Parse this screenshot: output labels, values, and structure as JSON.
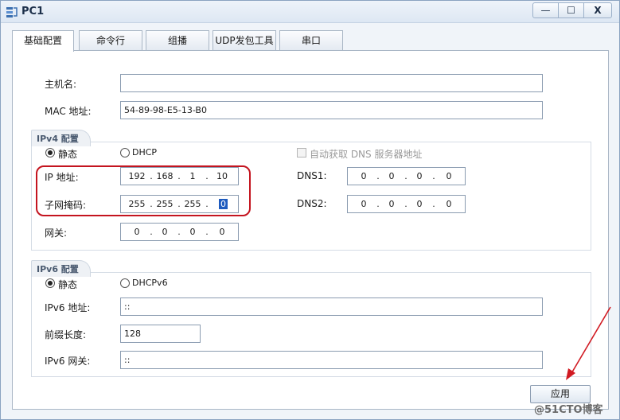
{
  "window": {
    "title": "PC1",
    "minimize": "—",
    "maximize": "☐",
    "close": "X"
  },
  "tabs": [
    {
      "label": "基础配置",
      "active": true
    },
    {
      "label": "命令行"
    },
    {
      "label": "组播"
    },
    {
      "label": "UDP发包工具"
    },
    {
      "label": "串口"
    }
  ],
  "basic": {
    "hostname_label": "主机名:",
    "hostname_value": "",
    "mac_label": "MAC 地址:",
    "mac_value": "54-89-98-E5-13-B0"
  },
  "ipv4": {
    "title": "IPv4 配置",
    "static_label": "静态",
    "dhcp_label": "DHCP",
    "auto_dns_label": "自动获取 DNS 服务器地址",
    "ip_label": "IP 地址:",
    "ip": [
      "192",
      "168",
      "1",
      "10"
    ],
    "mask_label": "子网掩码:",
    "mask": [
      "255",
      "255",
      "255",
      "0"
    ],
    "gateway_label": "网关:",
    "gateway": [
      "0",
      "0",
      "0",
      "0"
    ],
    "dns1_label": "DNS1:",
    "dns1": [
      "0",
      "0",
      "0",
      "0"
    ],
    "dns2_label": "DNS2:",
    "dns2": [
      "0",
      "0",
      "0",
      "0"
    ]
  },
  "ipv6": {
    "title": "IPv6 配置",
    "static_label": "静态",
    "dhcp_label": "DHCPv6",
    "addr_label": "IPv6 地址:",
    "addr_value": "::",
    "prefix_label": "前缀长度:",
    "prefix_value": "128",
    "gateway_label": "IPv6 网关:",
    "gateway_value": "::"
  },
  "apply_label": "应用",
  "watermark": "@51CTO博客",
  "colors": {
    "annotation_red": "#c4141f",
    "selection_blue": "#1e5bbf"
  }
}
